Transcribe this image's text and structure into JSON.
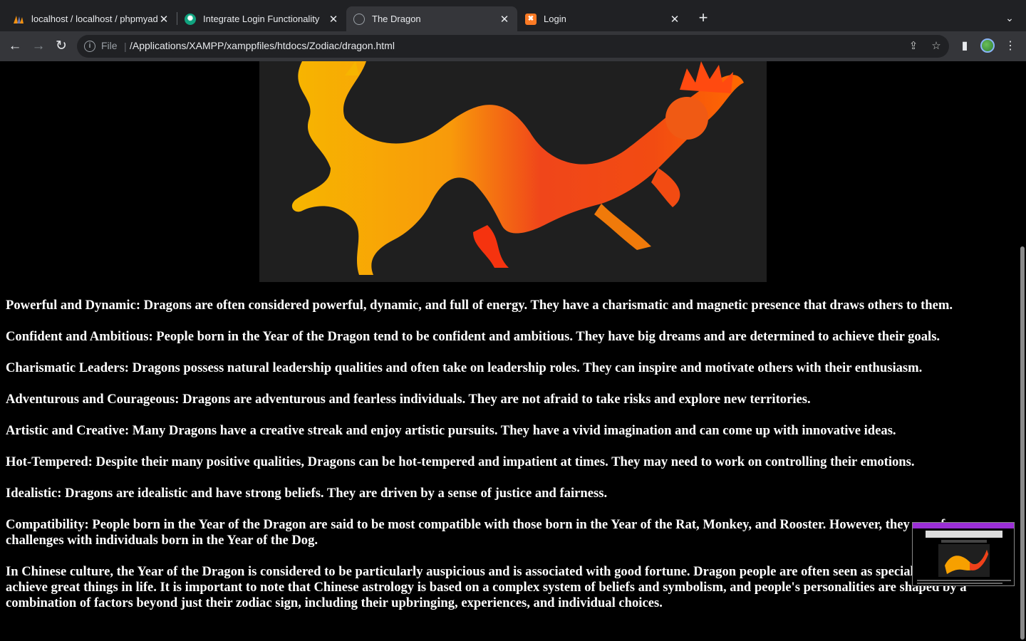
{
  "browser": {
    "tabs": [
      {
        "title": "localhost / localhost / phpmyad",
        "icon": "phpmyadmin-icon",
        "active": false
      },
      {
        "title": "Integrate Login Functionality",
        "icon": "chatgpt-icon",
        "active": false
      },
      {
        "title": "The Dragon",
        "icon": "globe-icon",
        "active": true
      },
      {
        "title": "Login",
        "icon": "xampp-icon",
        "active": false
      }
    ],
    "address": {
      "scheme": "File",
      "divider": "|",
      "url": "/Applications/XAMPP/xamppfiles/htdocs/Zodiac/dragon.html"
    }
  },
  "page": {
    "hero_image": "dragon-image",
    "paragraphs": [
      "Powerful and Dynamic: Dragons are often considered powerful, dynamic, and full of energy. They have a charismatic and magnetic presence that draws others to them.",
      "Confident and Ambitious: People born in the Year of the Dragon tend to be confident and ambitious. They have big dreams and are determined to achieve their goals.",
      "Charismatic Leaders: Dragons possess natural leadership qualities and often take on leadership roles. They can inspire and motivate others with their enthusiasm.",
      "Adventurous and Courageous: Dragons are adventurous and fearless individuals. They are not afraid to take risks and explore new territories.",
      "Artistic and Creative: Many Dragons have a creative streak and enjoy artistic pursuits. They have a vivid imagination and can come up with innovative ideas.",
      "Hot-Tempered: Despite their many positive qualities, Dragons can be hot-tempered and impatient at times. They may need to work on controlling their emotions.",
      "Idealistic: Dragons are idealistic and have strong beliefs. They are driven by a sense of justice and fairness.",
      "Compatibility: People born in the Year of the Dragon are said to be most compatible with those born in the Year of the Rat, Monkey, and Rooster. However, they may face challenges with individuals born in the Year of the Dog.",
      "In Chinese culture, the Year of the Dragon is considered to be particularly auspicious and is associated with good fortune. Dragon people are often seen as special and destined to achieve great things in life. It is important to note that Chinese astrology is based on a complex system of beliefs and symbolism, and people's personalities are shaped by a combination of factors beyond just their zodiac sign, including their upbringing, experiences, and individual choices."
    ]
  },
  "colors": {
    "page_bg": "#000000",
    "text": "#ffffff",
    "chrome_bg": "#202124",
    "toolbar_bg": "#35363a"
  }
}
